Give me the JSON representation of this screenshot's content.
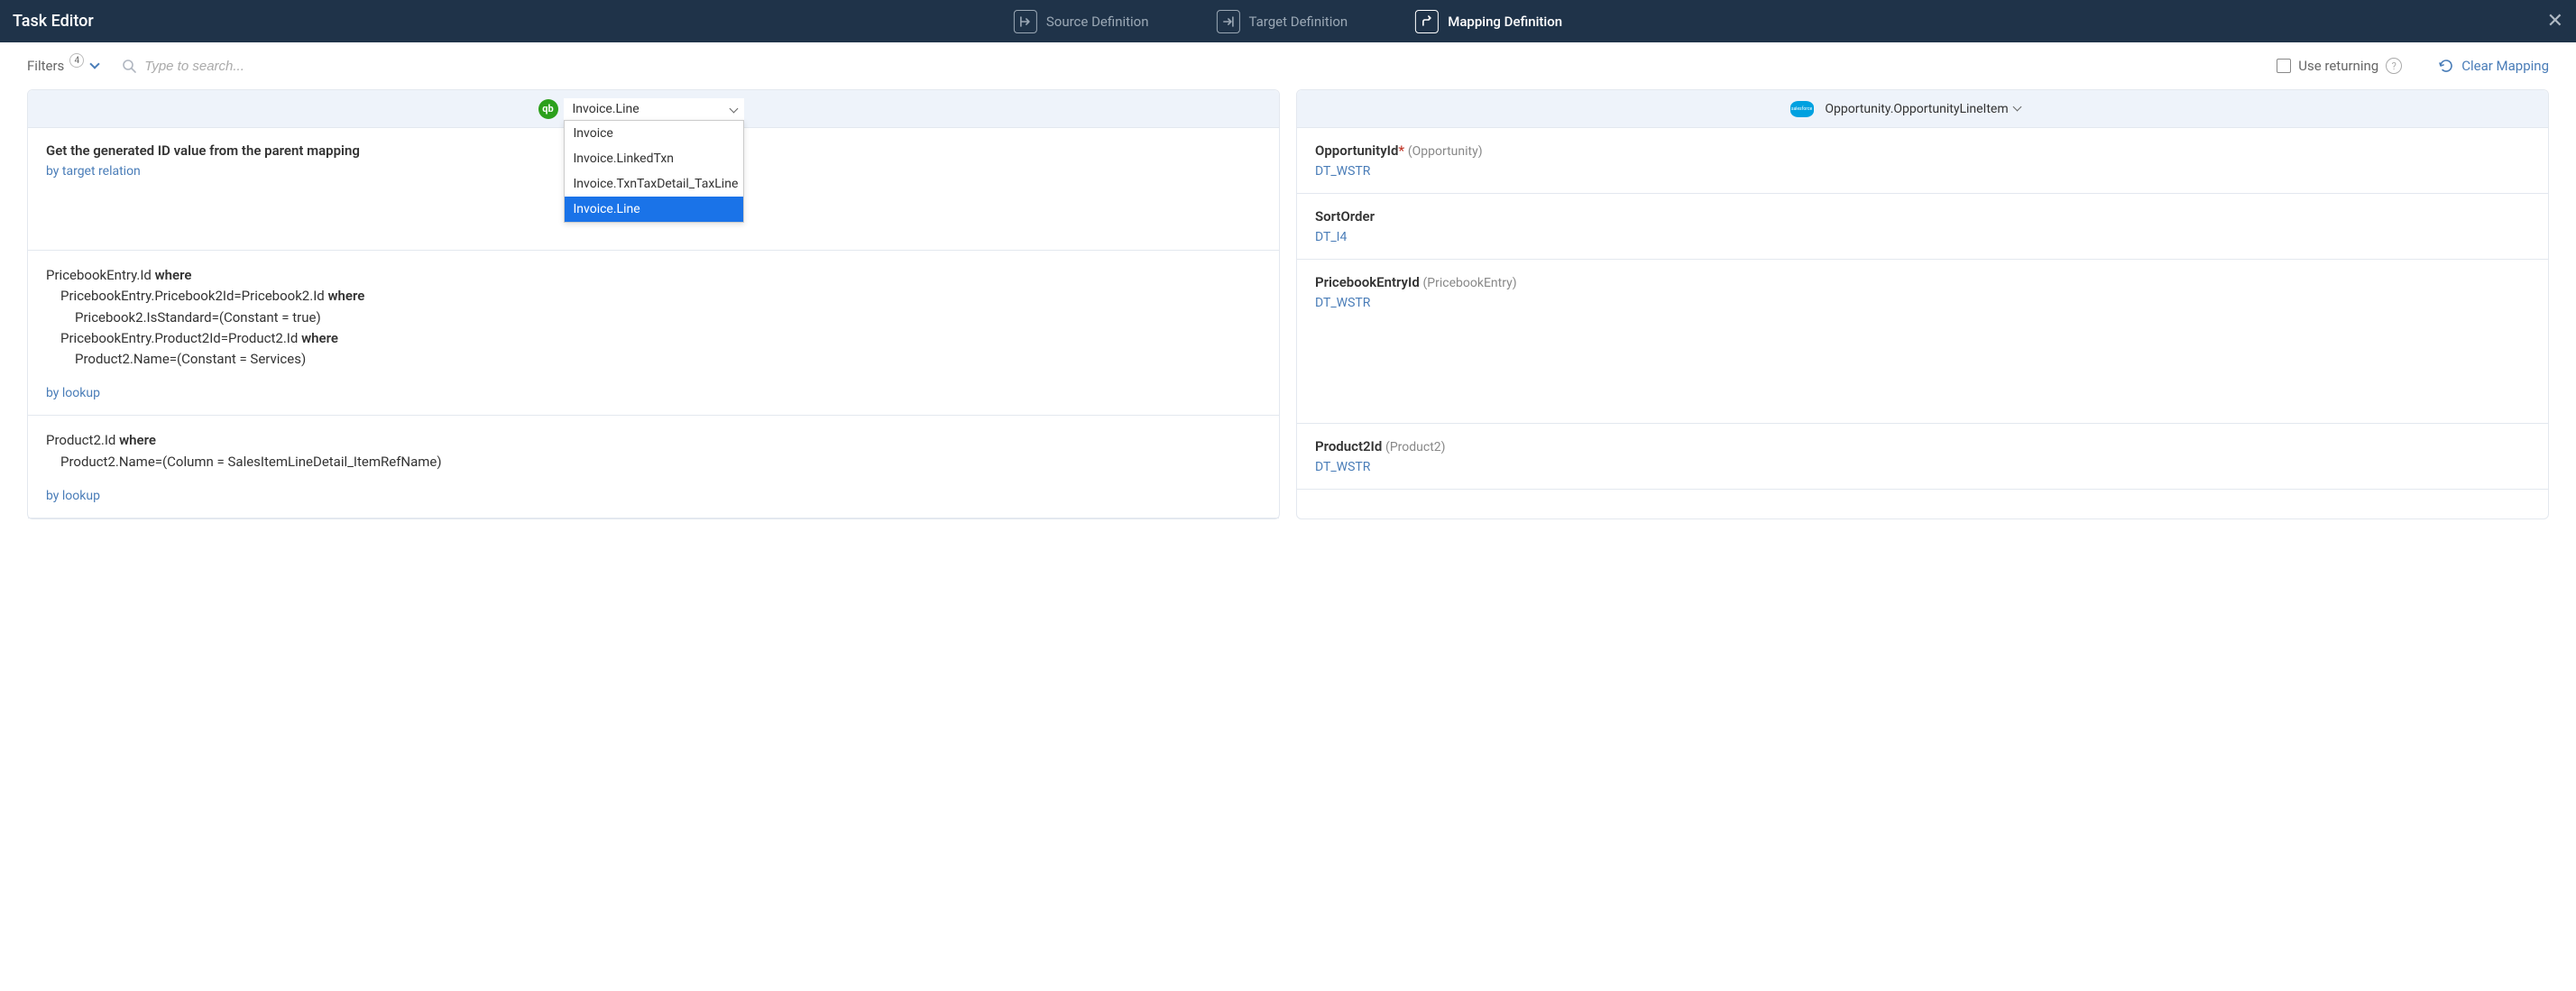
{
  "header": {
    "title": "Task Editor",
    "tabs": {
      "source": "Source Definition",
      "target": "Target Definition",
      "mapping": "Mapping Definition"
    }
  },
  "toolbar": {
    "filters_label": "Filters",
    "filters_count": "4",
    "search_placeholder": "Type to search...",
    "use_returning": "Use returning",
    "clear_mapping": "Clear Mapping"
  },
  "source": {
    "selected": "Invoice.Line",
    "options": [
      "Invoice",
      "Invoice.LinkedTxn",
      "Invoice.TxnTaxDetail_TaxLine",
      "Invoice.Line"
    ],
    "rows": [
      {
        "title": "Get the generated ID value from the parent mapping",
        "method": "by target relation"
      },
      {
        "expr": [
          {
            "indent": 0,
            "prefix": "PricebookEntry.Id ",
            "where": "where"
          },
          {
            "indent": 1,
            "prefix": "PricebookEntry.Pricebook2Id=Pricebook2.Id ",
            "where": "where"
          },
          {
            "indent": 2,
            "prefix": "Pricebook2.IsStandard=(Constant = true)"
          },
          {
            "indent": 1,
            "prefix": "PricebookEntry.Product2Id=Product2.Id ",
            "where": "where"
          },
          {
            "indent": 2,
            "prefix": "Product2.Name=(Constant = Services)"
          }
        ],
        "method": "by lookup"
      },
      {
        "expr": [
          {
            "indent": 0,
            "prefix": "Product2.Id ",
            "where": "where"
          },
          {
            "indent": 1,
            "prefix": "Product2.Name=(Column = SalesItemLineDetail_ItemRefName)"
          }
        ],
        "method": "by lookup"
      }
    ]
  },
  "target": {
    "selected": "Opportunity.OpportunityLineItem",
    "rows": [
      {
        "name": "OpportunityId",
        "required": true,
        "ref": "(Opportunity)",
        "type": "DT_WSTR"
      },
      {
        "name": "SortOrder",
        "required": false,
        "ref": "",
        "type": "DT_I4"
      },
      {
        "name": "PricebookEntryId",
        "required": false,
        "ref": "(PricebookEntry)",
        "type": "DT_WSTR"
      },
      {
        "name": "Product2Id",
        "required": false,
        "ref": "(Product2)",
        "type": "DT_WSTR"
      }
    ]
  }
}
